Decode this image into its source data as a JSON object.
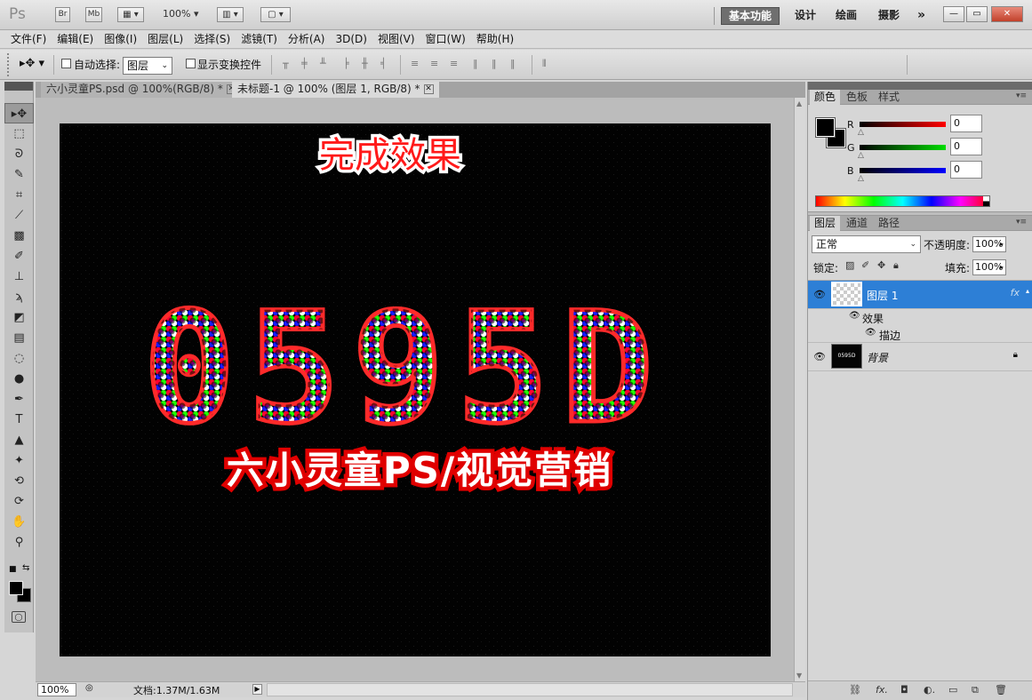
{
  "appbar": {
    "logo": "Ps",
    "bridge_label": "Br",
    "minibridge_label": "Mb",
    "zoom": "100%",
    "workspaces": [
      "基本功能",
      "设计",
      "绘画",
      "摄影"
    ],
    "more": "»",
    "win": {
      "minimize": "—",
      "restore": "▭",
      "close": "✕"
    }
  },
  "menu": [
    "文件(F)",
    "编辑(E)",
    "图像(I)",
    "图层(L)",
    "选择(S)",
    "滤镜(T)",
    "分析(A)",
    "3D(D)",
    "视图(V)",
    "窗口(W)",
    "帮助(H)"
  ],
  "options": {
    "auto_select_label": "自动选择:",
    "auto_select_target": "图层",
    "show_transform_label": "显示变换控件"
  },
  "tabs": [
    {
      "title": "六小灵童PS.psd @ 100%(RGB/8) *",
      "close": "✕"
    },
    {
      "title": "未标题-1 @ 100% (图层 1, RGB/8) *",
      "close": "✕"
    }
  ],
  "canvas": {
    "caption": "完成效果",
    "big_text": "0595D",
    "sub_text": "六小灵童PS/视觉营销"
  },
  "status": {
    "zoom": "100%",
    "doc_info": "文档:1.37M/1.63M",
    "play": "▶"
  },
  "color_panel": {
    "tabs": [
      "颜色",
      "色板",
      "样式"
    ],
    "channels": [
      {
        "label": "R",
        "value": "0",
        "color": "#ff0000"
      },
      {
        "label": "G",
        "value": "0",
        "color": "#00c000"
      },
      {
        "label": "B",
        "value": "0",
        "color": "#0000ff"
      }
    ]
  },
  "layers_panel": {
    "tabs": [
      "图层",
      "通道",
      "路径"
    ],
    "blend_mode": "正常",
    "opacity_label": "不透明度:",
    "opacity": "100%",
    "lock_label": "锁定:",
    "fill_label": "填充:",
    "fill": "100%",
    "layers": [
      {
        "name": "图层 1",
        "fx": "fx",
        "effects_label": "效果",
        "effect": "描边"
      },
      {
        "name": "背景",
        "thumb_text": "0595D"
      }
    ]
  },
  "colors": {
    "accent": "#2d7fd6",
    "canvas_bg": "#000000",
    "text_red": "#e00000"
  }
}
